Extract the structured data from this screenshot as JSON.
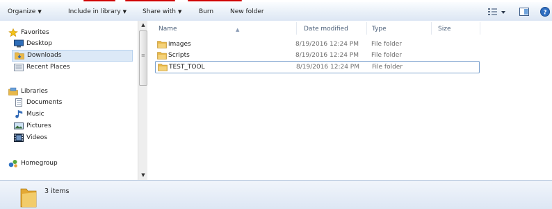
{
  "toolbar": {
    "organize": "Organize",
    "include_in_library": "Include in library",
    "share_with": "Share with",
    "burn": "Burn",
    "new_folder": "New folder",
    "dropdown_caret": "▼"
  },
  "navigation": {
    "favorites": {
      "label": "Favorites",
      "items": [
        "Desktop",
        "Downloads",
        "Recent Places"
      ]
    },
    "libraries": {
      "label": "Libraries",
      "items": [
        "Documents",
        "Music",
        "Pictures",
        "Videos"
      ]
    },
    "homegroup": {
      "label": "Homegroup"
    },
    "selected_item": "Downloads"
  },
  "columns": {
    "name": "Name",
    "date_modified": "Date modified",
    "type": "Type",
    "size": "Size"
  },
  "files": [
    {
      "name": "images",
      "date_modified": "8/19/2016 12:24 PM",
      "type": "File folder"
    },
    {
      "name": "Scripts",
      "date_modified": "8/19/2016 12:24 PM",
      "type": "File folder"
    },
    {
      "name": "TEST_TOOL",
      "date_modified": "8/19/2016 12:24 PM",
      "type": "File folder"
    }
  ],
  "status": {
    "item_count": "3 items"
  },
  "colors": {
    "selection": "#dce9f7",
    "focus_border": "#7da2ce",
    "folder": "#e8b84a",
    "annotation": "#d00000"
  },
  "icons": {
    "favorites": "star-icon",
    "desktop": "desktop-icon",
    "downloads": "downloads-folder-icon",
    "recent_places": "recent-places-icon",
    "libraries": "library-icon",
    "documents": "document-icon",
    "music": "music-note-icon",
    "pictures": "pictures-icon",
    "videos": "video-icon",
    "homegroup": "homegroup-icon",
    "folder": "folder-icon",
    "view_options": "view-options-icon",
    "preview_pane": "preview-pane-icon",
    "help": "help-icon"
  }
}
